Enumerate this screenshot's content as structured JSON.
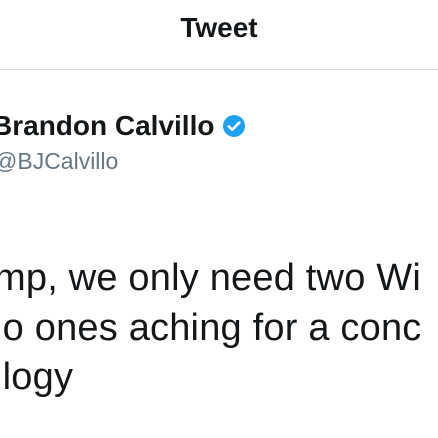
{
  "header": {
    "title": "Tweet"
  },
  "author": {
    "name": "Brandon Calvillo",
    "handle": "@BJCalvillo",
    "verified_icon": "verified-badge-icon",
    "verified_color": "#1da1f2"
  },
  "tweet": {
    "lines": [
      "mp, we only need two Wi",
      "lo ones aching for a conc",
      "ilogy"
    ]
  }
}
